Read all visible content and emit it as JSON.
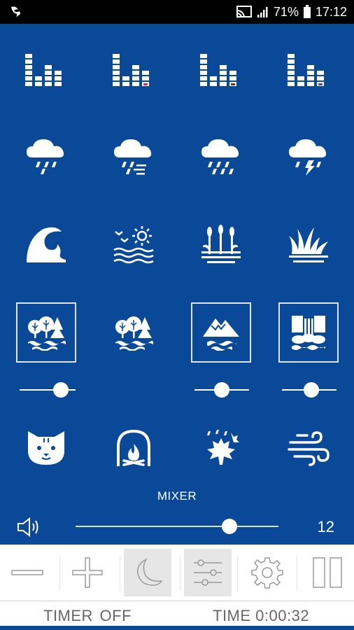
{
  "status_bar": {
    "battery": "71%",
    "time": "17:12",
    "icons": [
      "app-notification-icon",
      "cast-icon",
      "signal-icon",
      "battery-icon"
    ]
  },
  "sounds": [
    {
      "name": "equalizer-white-icon",
      "selected": false
    },
    {
      "name": "equalizer-pink-icon",
      "selected": false,
      "accent": "#e0208c"
    },
    {
      "name": "equalizer-brown-icon",
      "selected": false,
      "accent": "#6b3a1e"
    },
    {
      "name": "equalizer-violet-icon",
      "selected": false,
      "accent": "#5b3fc4"
    },
    {
      "name": "rain-light-icon",
      "selected": false
    },
    {
      "name": "rain-wind-icon",
      "selected": false
    },
    {
      "name": "rain-heavy-icon",
      "selected": false
    },
    {
      "name": "thunderstorm-icon",
      "selected": false
    },
    {
      "name": "ocean-wave-icon",
      "selected": false
    },
    {
      "name": "seaside-sun-icon",
      "selected": false
    },
    {
      "name": "swamp-reeds-icon",
      "selected": false
    },
    {
      "name": "grass-icon",
      "selected": false
    },
    {
      "name": "forest-lake-icon",
      "selected": true,
      "level": 0.82
    },
    {
      "name": "forest-river-icon",
      "selected": false
    },
    {
      "name": "mountain-lake-icon",
      "selected": true,
      "level": 0.5
    },
    {
      "name": "waterfall-icon",
      "selected": true,
      "level": 0.55
    },
    {
      "name": "cat-purr-icon",
      "selected": false
    },
    {
      "name": "fireplace-icon",
      "selected": false
    },
    {
      "name": "rain-leaves-icon",
      "selected": false
    },
    {
      "name": "wind-icon",
      "selected": false
    }
  ],
  "mixer": {
    "label": "MIXER",
    "volume_value": "12",
    "volume_level": 0.78
  },
  "toolbar": {
    "buttons": [
      "minus-icon",
      "plus-icon",
      "moon-icon",
      "sliders-icon",
      "gear-icon",
      "pause-icon"
    ],
    "active": [
      "moon-icon",
      "sliders-icon"
    ]
  },
  "footer": {
    "timer": "TIMER  OFF",
    "time": "TIME  0:00:32"
  },
  "colors": {
    "background": "#0a4898",
    "icon": "#ffffff",
    "toolbar_icon": "#9a9a9a"
  }
}
